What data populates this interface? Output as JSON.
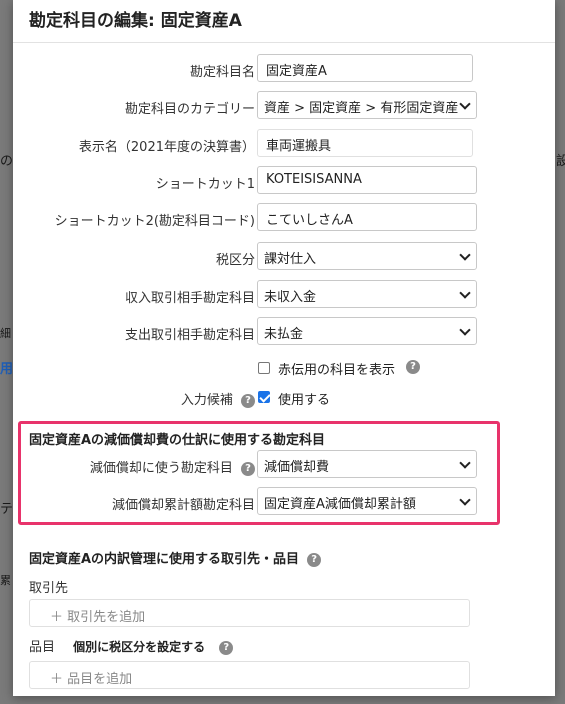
{
  "background": {
    "frag1": "の",
    "frag2": "設",
    "frag3": "用",
    "frag4": "テ",
    "frag5": "細",
    "frag6": "累"
  },
  "modal": {
    "title": "勘定科目の編集: 固定資産A",
    "fields": {
      "account_name": {
        "label": "勘定科目名",
        "value": "固定資産A"
      },
      "category": {
        "label": "勘定科目のカテゴリー",
        "value": "資産 > 固定資産 > 有形固定資産"
      },
      "display_name": {
        "label": "表示名（2021年度の決算書）",
        "value": "車両運搬具"
      },
      "shortcut1": {
        "label": "ショートカット1",
        "value": "KOTEISISANNA"
      },
      "shortcut2": {
        "label": "ショートカット2(勘定科目コード)",
        "value": "こていしさんA"
      },
      "tax_category": {
        "label": "税区分",
        "value": "課対仕入"
      },
      "income_counter": {
        "label": "収入取引相手勘定科目",
        "value": "未収入金"
      },
      "expense_counter": {
        "label": "支出取引相手勘定科目",
        "value": "未払金"
      }
    },
    "show_red_checkbox": {
      "label": "赤伝用の科目を表示",
      "checked": false
    },
    "input_candidate": {
      "label": "入力候補",
      "checkbox_label": "使用する",
      "checked": true
    },
    "depreciation_section": {
      "title": "固定資産Aの減価償却費の仕訳に使用する勘定科目",
      "dep_account": {
        "label": "減価償却に使う勘定科目",
        "value": "減価償却費"
      },
      "accum_account": {
        "label": "減価償却累計額勘定科目",
        "value": "固定資産A減価償却累計額"
      }
    },
    "breakdown_section": {
      "title": "固定資産Aの内訳管理に使用する取引先・品目",
      "partner_label": "取引先",
      "partner_add": "＋ 取引先を追加",
      "item_label": "品目",
      "item_tax_label": "個別に税区分を設定する",
      "item_add": "＋ 品目を追加"
    },
    "help_glyph": "?",
    "highlight_color": "#e8336b",
    "accent_color": "#1a73e8"
  }
}
